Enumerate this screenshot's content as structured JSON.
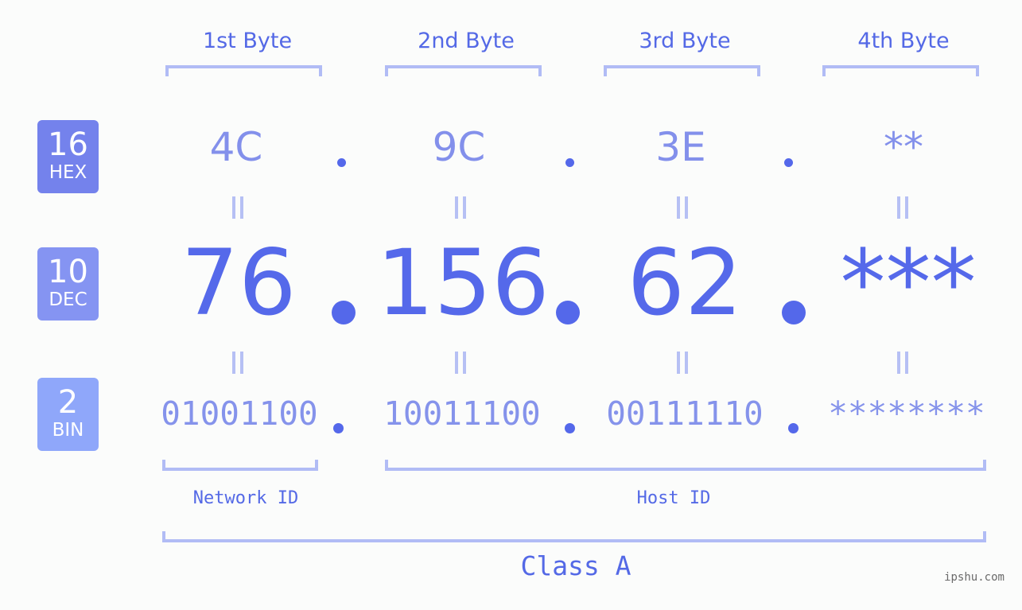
{
  "header": {
    "bytes": [
      "1st Byte",
      "2nd Byte",
      "3rd Byte",
      "4th Byte"
    ]
  },
  "bases": [
    {
      "radix": "16",
      "name": "HEX",
      "color": "#7482ec"
    },
    {
      "radix": "10",
      "name": "DEC",
      "color": "#8594f2"
    },
    {
      "radix": "2",
      "name": "BIN",
      "color": "#8fa7fa"
    }
  ],
  "ip": {
    "hex": [
      "4C",
      "9C",
      "3E",
      "**"
    ],
    "dec": [
      "76",
      "156",
      "62",
      "***"
    ],
    "bin": [
      "01001100",
      "10011100",
      "00111110",
      "********"
    ],
    "separator": ".",
    "equals_symbol": "="
  },
  "segments": {
    "network_id": "Network ID",
    "host_id": "Host ID",
    "class": "Class A"
  },
  "colors": {
    "accent": "#5469e6",
    "hex_text": "#8390eb",
    "dec_text": "#5569ea",
    "bin_text": "#8593eb",
    "bracket": "#b1bcf5"
  },
  "watermark": "ipshu.com"
}
